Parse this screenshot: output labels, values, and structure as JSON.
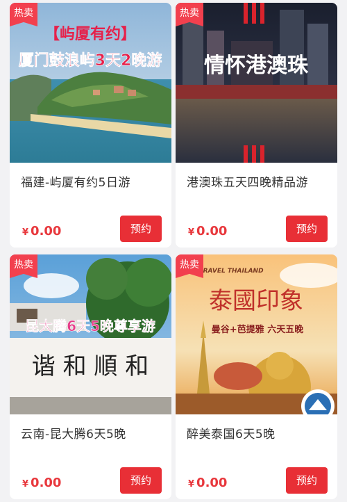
{
  "cards": [
    {
      "badge": "热卖",
      "image_text": "【屿厦有约】",
      "image_text2": "厦门鼓浪屿3天2晚游",
      "title": "福建-屿厦有约5日游",
      "currency": "¥",
      "price": "0.00",
      "button": "预约"
    },
    {
      "badge": "热卖",
      "image_text": "情怀港澳珠",
      "title": "港澳珠五天四晚精品游",
      "currency": "¥",
      "price": "0.00",
      "button": "预约"
    },
    {
      "badge": "热卖",
      "image_text": "昆大腾6天5晚尊享游",
      "image_text2": "谐 和 順 和",
      "title": "云南-昆大腾6天5晚",
      "currency": "¥",
      "price": "0.00",
      "button": "预约"
    },
    {
      "badge": "热卖",
      "image_text": "泰國印象",
      "image_text2": "曼谷+芭提雅 六天五晚",
      "image_text3": "TRAVEL THAILAND",
      "title": "醉美泰国6天5晚",
      "currency": "¥",
      "price": "0.00",
      "button": "预约"
    }
  ]
}
